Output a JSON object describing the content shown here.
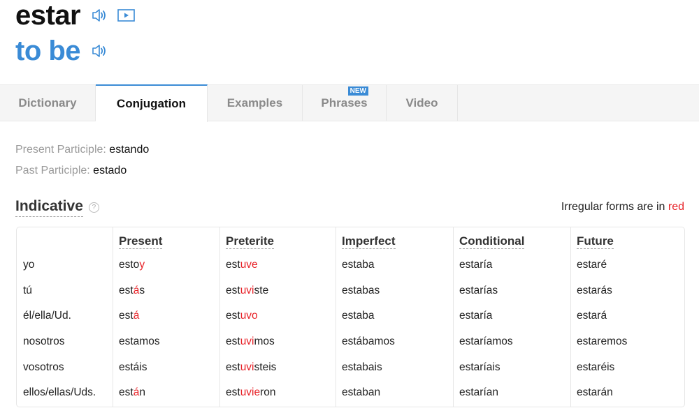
{
  "header": {
    "headword": "estar",
    "translation": "to be",
    "icons": {
      "headword_audio": "speaker-icon",
      "headword_video": "play-video-icon",
      "translation_audio": "speaker-icon"
    },
    "accent_color": "#3a8bd6"
  },
  "tabs": [
    {
      "label": "Dictionary",
      "active": false
    },
    {
      "label": "Conjugation",
      "active": true
    },
    {
      "label": "Examples",
      "active": false
    },
    {
      "label": "Phrases",
      "active": false,
      "badge": "NEW"
    },
    {
      "label": "Video",
      "active": false
    }
  ],
  "participles": {
    "present_label": "Present Participle:",
    "present_value": "estando",
    "past_label": "Past Participle:",
    "past_value": "estado"
  },
  "section": {
    "title": "Indicative",
    "help_icon": "question-circle-icon",
    "note_prefix": "Irregular forms are in",
    "note_highlight": "red",
    "irregular_color": "#e8242a"
  },
  "table": {
    "pronouns": [
      "yo",
      "tú",
      "él/ella/Ud.",
      "nosotros",
      "vosotros",
      "ellos/ellas/Uds."
    ],
    "tenses": [
      {
        "name": "Present",
        "forms": [
          [
            {
              "t": "esto",
              "irr": false
            },
            {
              "t": "y",
              "irr": true
            }
          ],
          [
            {
              "t": "est",
              "irr": false
            },
            {
              "t": "á",
              "irr": true
            },
            {
              "t": "s",
              "irr": false
            }
          ],
          [
            {
              "t": "est",
              "irr": false
            },
            {
              "t": "á",
              "irr": true
            }
          ],
          [
            {
              "t": "estamos",
              "irr": false
            }
          ],
          [
            {
              "t": "estáis",
              "irr": false
            }
          ],
          [
            {
              "t": "est",
              "irr": false
            },
            {
              "t": "á",
              "irr": true
            },
            {
              "t": "n",
              "irr": false
            }
          ]
        ]
      },
      {
        "name": "Preterite",
        "forms": [
          [
            {
              "t": "est",
              "irr": false
            },
            {
              "t": "uve",
              "irr": true
            }
          ],
          [
            {
              "t": "est",
              "irr": false
            },
            {
              "t": "uvi",
              "irr": true
            },
            {
              "t": "ste",
              "irr": false
            }
          ],
          [
            {
              "t": "est",
              "irr": false
            },
            {
              "t": "uvo",
              "irr": true
            }
          ],
          [
            {
              "t": "est",
              "irr": false
            },
            {
              "t": "uvi",
              "irr": true
            },
            {
              "t": "mos",
              "irr": false
            }
          ],
          [
            {
              "t": "est",
              "irr": false
            },
            {
              "t": "uvi",
              "irr": true
            },
            {
              "t": "steis",
              "irr": false
            }
          ],
          [
            {
              "t": "est",
              "irr": false
            },
            {
              "t": "uvie",
              "irr": true
            },
            {
              "t": "ron",
              "irr": false
            }
          ]
        ]
      },
      {
        "name": "Imperfect",
        "forms": [
          [
            {
              "t": "estaba",
              "irr": false
            }
          ],
          [
            {
              "t": "estabas",
              "irr": false
            }
          ],
          [
            {
              "t": "estaba",
              "irr": false
            }
          ],
          [
            {
              "t": "estábamos",
              "irr": false
            }
          ],
          [
            {
              "t": "estabais",
              "irr": false
            }
          ],
          [
            {
              "t": "estaban",
              "irr": false
            }
          ]
        ]
      },
      {
        "name": "Conditional",
        "forms": [
          [
            {
              "t": "estaría",
              "irr": false
            }
          ],
          [
            {
              "t": "estarías",
              "irr": false
            }
          ],
          [
            {
              "t": "estaría",
              "irr": false
            }
          ],
          [
            {
              "t": "estaríamos",
              "irr": false
            }
          ],
          [
            {
              "t": "estaríais",
              "irr": false
            }
          ],
          [
            {
              "t": "estarían",
              "irr": false
            }
          ]
        ]
      },
      {
        "name": "Future",
        "forms": [
          [
            {
              "t": "estaré",
              "irr": false
            }
          ],
          [
            {
              "t": "estarás",
              "irr": false
            }
          ],
          [
            {
              "t": "estará",
              "irr": false
            }
          ],
          [
            {
              "t": "estaremos",
              "irr": false
            }
          ],
          [
            {
              "t": "estaréis",
              "irr": false
            }
          ],
          [
            {
              "t": "estarán",
              "irr": false
            }
          ]
        ]
      }
    ]
  }
}
